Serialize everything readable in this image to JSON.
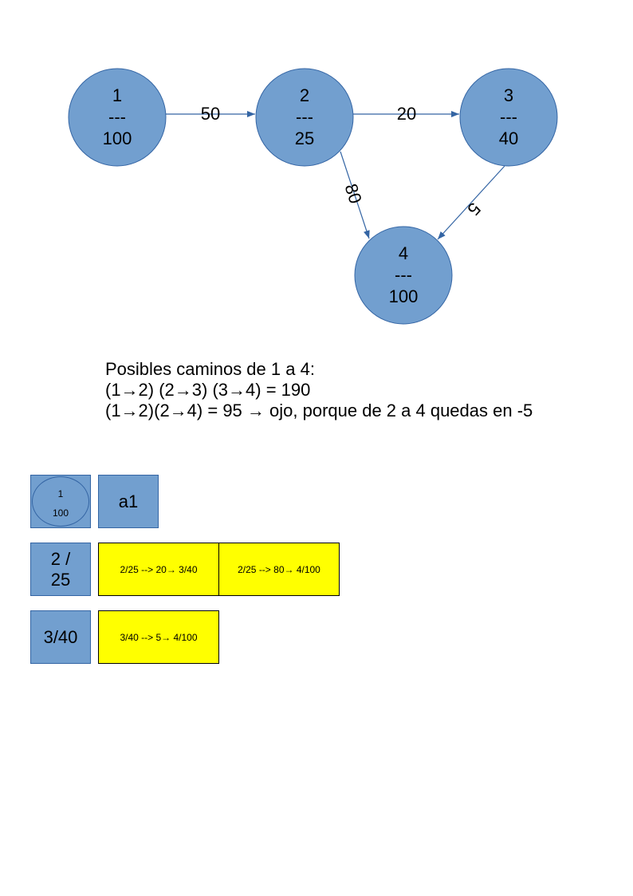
{
  "graph": {
    "nodes": [
      {
        "id": "1",
        "line1": "1",
        "line2": "---",
        "line3": "100"
      },
      {
        "id": "2",
        "line1": "2",
        "line2": "---",
        "line3": "25"
      },
      {
        "id": "3",
        "line1": "3",
        "line2": "---",
        "line3": "40"
      },
      {
        "id": "4",
        "line1": "4",
        "line2": "---",
        "line3": "100"
      }
    ],
    "edges": [
      {
        "from": "1",
        "to": "2",
        "label": "50"
      },
      {
        "from": "2",
        "to": "3",
        "label": "20"
      },
      {
        "from": "2",
        "to": "4",
        "label": "80"
      },
      {
        "from": "3",
        "to": "4",
        "label": "5"
      }
    ],
    "node_color": "#729fcf",
    "edge_color": "#3465a4"
  },
  "caption": {
    "line1": "Posibles caminos de 1 a 4:",
    "line2": "(1→2) (2→3) (3→4) = 190",
    "line3": "(1→2)(2→4) = 95 → ojo, porque de 2 a 4 quedas en -5"
  },
  "table": {
    "row1": {
      "key_top": "1",
      "key_bottom": "100",
      "value": "a1"
    },
    "row2": {
      "key": "2 / 25",
      "cell1": "2/25 --> 20→ 3/40",
      "cell2": "2/25 --> 80→ 4/100"
    },
    "row3": {
      "key": "3/40",
      "cell1": "3/40 --> 5→ 4/100"
    },
    "highlight_color": "#ffff00"
  }
}
